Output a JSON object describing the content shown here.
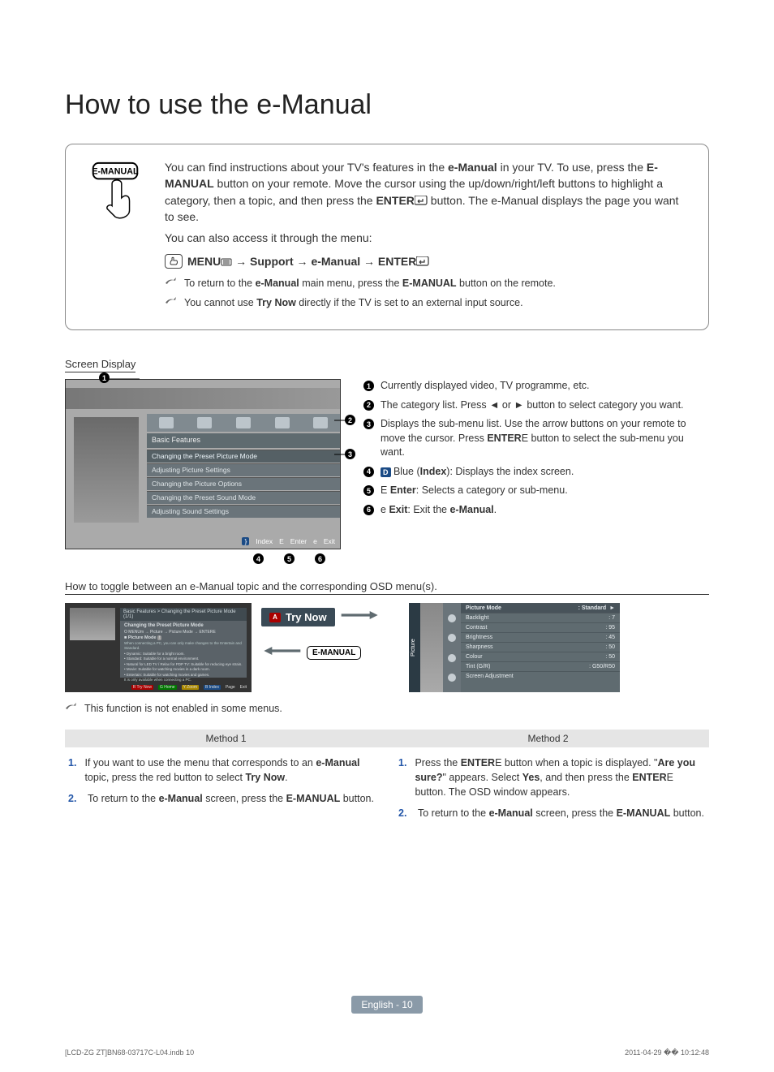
{
  "title": "How to use the e-Manual",
  "remote_label": "E-MANUAL",
  "intro": {
    "p1_a": "You can find instructions about your TV's features in the ",
    "p1_b": "e-Manual",
    "p1_c": " in your TV. To use, press the ",
    "p1_d": "E-MANUAL",
    "p1_e": " button on your remote. Move the cursor using the up/down/right/left buttons to highlight a category, then a topic, and then press the ",
    "p1_f": "ENTER",
    "p1_g": " button. The e-Manual displays the page you want to see.",
    "p2": "You can also access it through the menu:",
    "menu_a": "MENU",
    "menu_b": " → Support → e-Manual → ",
    "menu_c": "ENTER",
    "note1_a": "To return to the ",
    "note1_b": "e-Manual",
    "note1_c": " main menu, press the ",
    "note1_d": "E-MANUAL",
    "note1_e": " button on the remote.",
    "note2_a": "You cannot use ",
    "note2_b": "Try Now",
    "note2_c": " directly if the TV is set to an external input source."
  },
  "sd_heading": "Screen Display",
  "tv": {
    "cat_label": "Basic Features",
    "rows": [
      "Changing the Preset Picture Mode",
      "Adjusting Picture Settings",
      "Changing the Picture Options",
      "Changing the Preset Sound Mode",
      "Adjusting Sound Settings"
    ],
    "fbar": {
      "index": "Index",
      "enter": "Enter",
      "exit": "Exit"
    }
  },
  "sd_items": [
    {
      "n": "1",
      "html": "Currently displayed video, TV programme, etc."
    },
    {
      "n": "2",
      "html": "The category list. Press ◄ or ► button to select category you want."
    },
    {
      "n": "3",
      "html": "Displays the sub-menu list. Use the arrow buttons on your remote to move the cursor. Press <b>ENTER</b>E button to select the sub-menu you want."
    },
    {
      "n": "4",
      "html": "<span class='blue-chip'>D</span> Blue (<b>Index</b>): Displays the index screen."
    },
    {
      "n": "5",
      "html": "E <b>Enter</b>: Selects a category or sub-menu."
    },
    {
      "n": "6",
      "html": "e <b>Exit</b>: Exit the <b>e-Manual</b>."
    }
  ],
  "toggle_heading": "How to toggle between an e-Manual topic and the corresponding OSD menu(s).",
  "leftshot": {
    "hdr": "Basic Features > Changing the Preset Picture Mode (1/1)",
    "title": "Changing the Preset Picture Mode",
    "path": "MENUm → Picture → Picture Mode → ENTERE",
    "opt_lead": "Picture Mode",
    "opt_tag": "t",
    "note1": "When connecting a PC, you can only make changes to the Entertain and Standard.",
    "bullets": [
      "Dynamic: Suitable for a bright room.",
      "Standard: Suitable for a normal environment.",
      "Natural for LED TV / Relax for PDP TV: Suitable for reducing eye strain.",
      "Movie: Suitable for watching movies in a dark room.",
      "Entertain: Suitable for watching movies and games."
    ],
    "subnote": "It is only available when connecting a PC.",
    "foot": [
      "Try Now",
      "Home",
      "Zoom",
      "Index",
      "Page",
      "Exit"
    ]
  },
  "pill_try": "Try Now",
  "pill_em": "E-MANUAL",
  "rightshot": {
    "tab": "Picture",
    "rows": [
      {
        "k": "Picture Mode",
        "v": ": Standard",
        "hd": true,
        "arrow": "►"
      },
      {
        "k": "Backlight",
        "v": ": 7"
      },
      {
        "k": "Contrast",
        "v": ": 95"
      },
      {
        "k": "Brightness",
        "v": ": 45"
      },
      {
        "k": "Sharpness",
        "v": ": 50"
      },
      {
        "k": "Colour",
        "v": ": 50"
      },
      {
        "k": "Tint (G/R)",
        "v": ": G50/R50"
      },
      {
        "k": "Screen Adjustment",
        "v": ""
      }
    ]
  },
  "toggle_note_a": "This function is not enabled in some menus.",
  "method1": "Method 1",
  "method2": "Method 2",
  "m1": [
    {
      "n": "1.",
      "html": "If you want to use the menu that corresponds to an <b>e-Manual</b> topic, press the red button to select <b>Try Now</b>."
    },
    {
      "n": "2.",
      "html": "To return to the <b>e-Manual</b> screen, press the <b>E-MANUAL</b> button."
    }
  ],
  "m2": [
    {
      "n": "1.",
      "html": "Press the <b>ENTER</b>E button when a topic is displayed. \"<b>Are you sure?</b>\" appears. Select <b>Yes</b>, and then press the <b>ENTER</b>E button. The OSD window appears."
    },
    {
      "n": "2.",
      "html": "To return to the <b>e-Manual</b> screen, press the <b>E-MANUAL</b> button."
    }
  ],
  "pgnum": "English - 10",
  "printmark_left": "[LCD-ZG ZT]BN68-03717C-L04.indb   10",
  "printmark_right": "2011-04-29   �� 10:12:48"
}
